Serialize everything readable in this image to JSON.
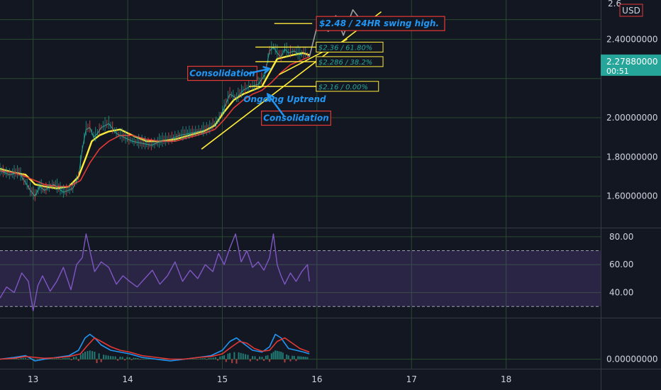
{
  "chart_data": [
    {
      "type": "line",
      "panel": "price",
      "currency": "USD",
      "x_ticks": [
        13,
        14,
        15,
        16,
        17,
        18
      ],
      "xlim": [
        12.65,
        19.0
      ],
      "ylim": [
        1.44,
        2.6
      ],
      "y_ticks": [
        {
          "value": 1.6,
          "label": "1.60000000"
        },
        {
          "value": 1.8,
          "label": "1.80000000"
        },
        {
          "value": 2.0,
          "label": "2.00000000"
        },
        {
          "value": 2.4,
          "label": "2.40000000"
        }
      ],
      "y_top_label_partial": "2.6",
      "price_tag": {
        "value": 2.2788,
        "label": "2.27880000",
        "countdown": "00:51",
        "color": "#26a69a"
      },
      "grid": true,
      "series": [
        {
          "role": "price",
          "color": "#26a69a",
          "x": [
            12.65,
            12.75,
            12.85,
            12.92,
            12.97,
            13.02,
            13.07,
            13.12,
            13.22,
            13.32,
            13.42,
            13.48,
            13.52,
            13.56,
            13.6,
            13.64,
            13.68,
            13.72,
            13.8,
            13.88,
            13.96,
            14.05,
            14.15,
            14.25,
            14.35,
            14.45,
            14.55,
            14.65,
            14.75,
            14.85,
            14.95,
            15.02,
            15.08,
            15.15,
            15.22,
            15.3,
            15.38,
            15.45,
            15.5,
            15.54,
            15.58,
            15.62,
            15.66,
            15.7,
            15.76,
            15.82,
            15.88,
            15.92
          ],
          "values": [
            1.73,
            1.71,
            1.72,
            1.67,
            1.63,
            1.6,
            1.65,
            1.63,
            1.66,
            1.62,
            1.64,
            1.7,
            1.84,
            1.94,
            1.95,
            1.9,
            1.92,
            1.95,
            1.97,
            1.92,
            1.9,
            1.88,
            1.87,
            1.86,
            1.88,
            1.89,
            1.91,
            1.92,
            1.93,
            1.94,
            1.98,
            2.05,
            2.12,
            2.1,
            2.14,
            2.16,
            2.17,
            2.22,
            2.34,
            2.36,
            2.33,
            2.31,
            2.35,
            2.33,
            2.34,
            2.32,
            2.33,
            2.31
          ]
        },
        {
          "role": "moving-average-fast",
          "color": "#ffeb3b",
          "x": [
            12.65,
            12.8,
            12.92,
            13.02,
            13.12,
            13.25,
            13.38,
            13.48,
            13.56,
            13.62,
            13.7,
            13.8,
            13.92,
            14.05,
            14.2,
            14.35,
            14.5,
            14.65,
            14.8,
            14.92,
            15.02,
            15.12,
            15.22,
            15.32,
            15.42,
            15.5,
            15.58,
            15.66,
            15.75,
            15.85,
            15.92
          ],
          "values": [
            1.74,
            1.72,
            1.71,
            1.66,
            1.65,
            1.64,
            1.65,
            1.7,
            1.8,
            1.88,
            1.91,
            1.93,
            1.94,
            1.91,
            1.88,
            1.88,
            1.89,
            1.91,
            1.93,
            1.96,
            2.03,
            2.09,
            2.12,
            2.14,
            2.16,
            2.23,
            2.3,
            2.31,
            2.32,
            2.33,
            2.32
          ]
        },
        {
          "role": "moving-average-slow",
          "color": "#e53935",
          "x": [
            12.65,
            12.8,
            12.92,
            13.02,
            13.12,
            13.25,
            13.38,
            13.5,
            13.6,
            13.7,
            13.8,
            13.92,
            14.05,
            14.2,
            14.35,
            14.5,
            14.65,
            14.8,
            14.92,
            15.02,
            15.12,
            15.22,
            15.32,
            15.42,
            15.52,
            15.62,
            15.72,
            15.82,
            15.92
          ],
          "values": [
            1.73,
            1.72,
            1.7,
            1.68,
            1.66,
            1.65,
            1.65,
            1.68,
            1.77,
            1.84,
            1.88,
            1.91,
            1.91,
            1.89,
            1.88,
            1.88,
            1.9,
            1.92,
            1.94,
            1.99,
            2.05,
            2.09,
            2.12,
            2.14,
            2.18,
            2.23,
            2.27,
            2.29,
            2.31
          ]
        },
        {
          "role": "projection",
          "color": "#9e9e9e",
          "x": [
            15.92,
            16.02,
            16.12,
            16.2,
            16.28,
            16.38,
            16.46
          ],
          "values": [
            2.31,
            2.5,
            2.44,
            2.52,
            2.42,
            2.55,
            2.5
          ]
        }
      ],
      "trendlines": [
        {
          "x": [
            14.78,
            16.68
          ],
          "values": [
            1.84,
            2.54
          ],
          "color": "#ffeb3b"
        },
        {
          "x": [
            15.6,
            16.32
          ],
          "values": [
            2.22,
            2.4
          ],
          "color": "#ffeb3b"
        }
      ],
      "fib_levels": [
        {
          "value": 2.48,
          "label": "$2.48 / 24HR swing high.",
          "x": [
            15.55,
            15.95
          ],
          "boxed": true
        },
        {
          "value": 2.36,
          "label": "$2.36 / 61.80%",
          "x": [
            15.35,
            16.0
          ],
          "boxed": false
        },
        {
          "value": 2.286,
          "label": "$2.286 / 38.2%",
          "x": [
            15.35,
            16.0
          ],
          "boxed": false
        },
        {
          "value": 2.16,
          "label": "$2.16 / 0.00%",
          "x": [
            15.28,
            16.0
          ],
          "boxed": false
        }
      ],
      "annotations": [
        {
          "text": "Consolidation",
          "x": 15.0,
          "value": 2.226,
          "boxed": true
        },
        {
          "text": "Ongoing Uptrend",
          "x": 15.66,
          "value": 2.094,
          "boxed": false
        },
        {
          "text": "Consolidation",
          "x": 15.78,
          "value": 1.998,
          "boxed": true
        }
      ]
    },
    {
      "type": "line",
      "panel": "oscillator",
      "xlim": [
        12.65,
        19.0
      ],
      "ylim": [
        22,
        86
      ],
      "y_ticks": [
        {
          "value": 40,
          "label": "40.00"
        },
        {
          "value": 60,
          "label": "60.00"
        },
        {
          "value": 80,
          "label": "80.00"
        }
      ],
      "band": {
        "lower": 30,
        "upper": 70
      },
      "series": [
        {
          "role": "oscillator",
          "color": "#7e57c2",
          "x": [
            12.65,
            12.72,
            12.8,
            12.88,
            12.95,
            13.0,
            13.05,
            13.1,
            13.18,
            13.25,
            13.32,
            13.4,
            13.46,
            13.52,
            13.56,
            13.6,
            13.65,
            13.72,
            13.8,
            13.88,
            13.95,
            14.02,
            14.1,
            14.18,
            14.26,
            14.34,
            14.42,
            14.5,
            14.58,
            14.66,
            14.74,
            14.82,
            14.9,
            14.96,
            15.02,
            15.08,
            15.14,
            15.2,
            15.26,
            15.32,
            15.38,
            15.44,
            15.5,
            15.54,
            15.58,
            15.62,
            15.66,
            15.72,
            15.78,
            15.84,
            15.9,
            15.92
          ],
          "values": [
            36,
            44,
            40,
            54,
            48,
            27,
            45,
            52,
            41,
            48,
            58,
            42,
            60,
            65,
            82,
            70,
            55,
            62,
            58,
            46,
            52,
            48,
            44,
            50,
            56,
            46,
            52,
            62,
            48,
            56,
            50,
            60,
            55,
            68,
            60,
            72,
            82,
            62,
            70,
            58,
            62,
            56,
            65,
            82,
            60,
            52,
            46,
            54,
            48,
            55,
            60,
            48
          ]
        }
      ]
    },
    {
      "type": "line",
      "panel": "macd",
      "xlim": [
        12.65,
        19.0
      ],
      "ylim": [
        -0.05,
        0.23
      ],
      "y_ticks": [
        {
          "value": 0,
          "label": "0.00000000"
        }
      ],
      "series": [
        {
          "role": "macd-line",
          "color": "#2196f3",
          "x": [
            12.65,
            12.8,
            12.92,
            13.02,
            13.12,
            13.25,
            13.38,
            13.48,
            13.55,
            13.6,
            13.65,
            13.72,
            13.82,
            13.92,
            14.02,
            14.15,
            14.3,
            14.45,
            14.6,
            14.75,
            14.88,
            15.0,
            15.08,
            15.15,
            15.22,
            15.32,
            15.42,
            15.5,
            15.56,
            15.62,
            15.7,
            15.78,
            15.86,
            15.92
          ],
          "values": [
            0.0,
            0.01,
            0.02,
            -0.01,
            0.0,
            0.01,
            0.02,
            0.05,
            0.12,
            0.14,
            0.12,
            0.08,
            0.05,
            0.04,
            0.03,
            0.01,
            0.0,
            -0.01,
            0.0,
            0.01,
            0.02,
            0.05,
            0.1,
            0.12,
            0.09,
            0.05,
            0.04,
            0.07,
            0.14,
            0.12,
            0.06,
            0.05,
            0.04,
            0.03
          ]
        },
        {
          "role": "signal-line",
          "color": "#e53935",
          "x": [
            12.65,
            12.8,
            12.92,
            13.02,
            13.12,
            13.25,
            13.38,
            13.5,
            13.58,
            13.65,
            13.72,
            13.82,
            13.92,
            14.02,
            14.15,
            14.3,
            14.45,
            14.6,
            14.75,
            14.88,
            15.0,
            15.1,
            15.18,
            15.26,
            15.34,
            15.42,
            15.5,
            15.58,
            15.66,
            15.74,
            15.82,
            15.92
          ],
          "values": [
            0.0,
            0.005,
            0.015,
            0.01,
            0.005,
            0.008,
            0.015,
            0.03,
            0.08,
            0.12,
            0.1,
            0.07,
            0.05,
            0.04,
            0.02,
            0.01,
            0.0,
            0.0,
            0.01,
            0.015,
            0.03,
            0.07,
            0.1,
            0.09,
            0.06,
            0.045,
            0.05,
            0.1,
            0.12,
            0.09,
            0.06,
            0.04
          ]
        }
      ]
    }
  ]
}
